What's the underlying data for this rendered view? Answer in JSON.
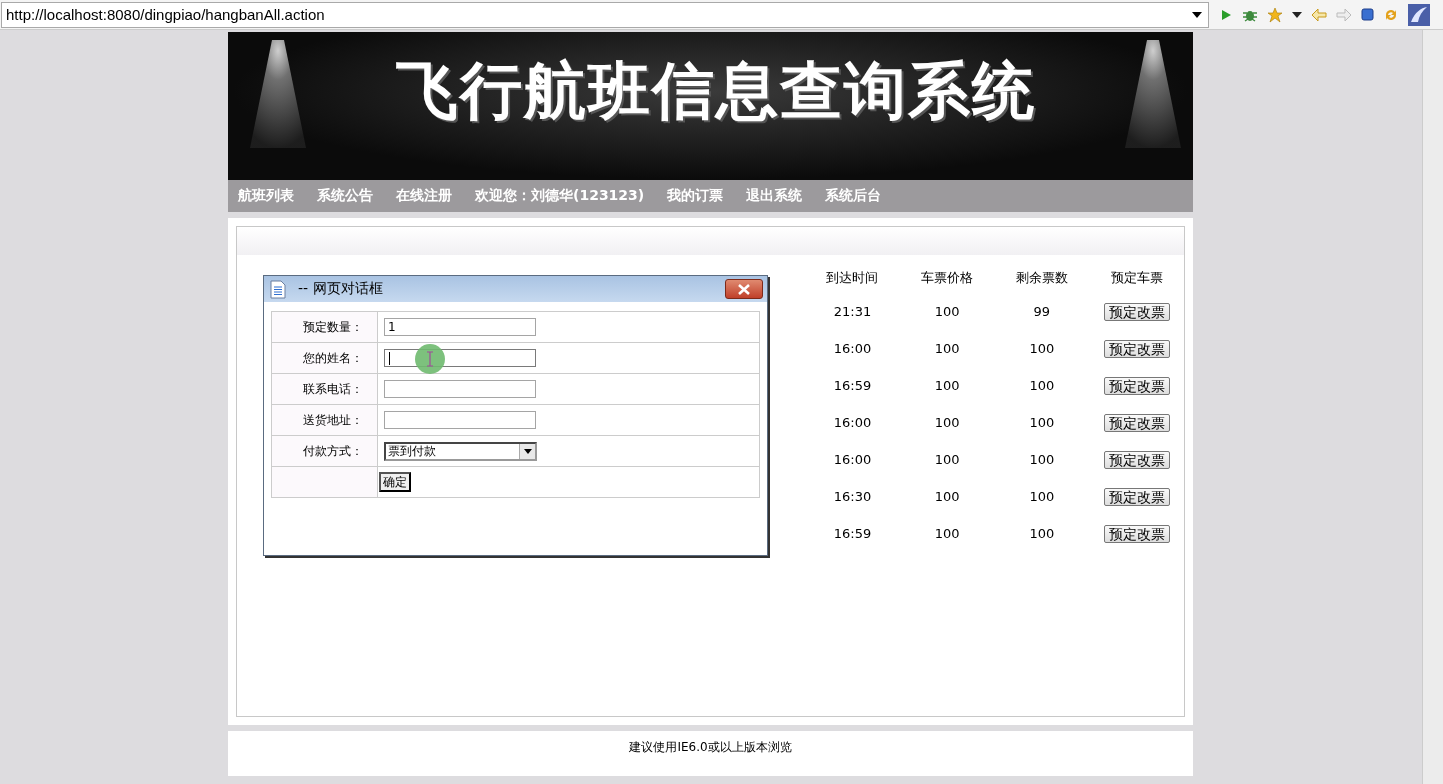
{
  "address_bar": {
    "url": "http://localhost:8080/dingpiao/hangbanAll.action"
  },
  "banner": {
    "title": "飞行航班信息查询系统"
  },
  "nav": {
    "items": [
      "航班列表",
      "系统公告",
      "在线注册",
      "欢迎您：刘德华(123123)",
      "我的订票",
      "退出系统",
      "系统后台"
    ]
  },
  "table": {
    "columns": [
      "到达时间",
      "车票价格",
      "剩余票数",
      "预定车票"
    ],
    "rows": [
      {
        "arrival": "21:31",
        "price": "100",
        "remaining": "99",
        "action": "预定改票"
      },
      {
        "arrival": "16:00",
        "price": "100",
        "remaining": "100",
        "action": "预定改票"
      },
      {
        "arrival": "16:59",
        "price": "100",
        "remaining": "100",
        "action": "预定改票"
      },
      {
        "arrival": "16:00",
        "price": "100",
        "remaining": "100",
        "action": "预定改票"
      },
      {
        "arrival": "16:00",
        "price": "100",
        "remaining": "100",
        "action": "预定改票"
      },
      {
        "arrival": "16:30",
        "price": "100",
        "remaining": "100",
        "action": "预定改票"
      },
      {
        "arrival": "16:59",
        "price": "100",
        "remaining": "100",
        "action": "预定改票"
      }
    ]
  },
  "dialog": {
    "title": "-- 网页对话框",
    "fields": [
      {
        "label": "预定数量：",
        "kind": "text",
        "value": "1",
        "focused": false
      },
      {
        "label": "您的姓名：",
        "kind": "text",
        "focused": true
      },
      {
        "label": "联系电话：",
        "kind": "text",
        "focused": false
      },
      {
        "label": "送货地址：",
        "kind": "text",
        "focused": false
      },
      {
        "label": "付款方式：",
        "kind": "select",
        "value": "票到付款",
        "focused": false
      }
    ],
    "submit": "确定"
  },
  "footer": {
    "text": "建议使用IE6.0或以上版本浏览"
  }
}
